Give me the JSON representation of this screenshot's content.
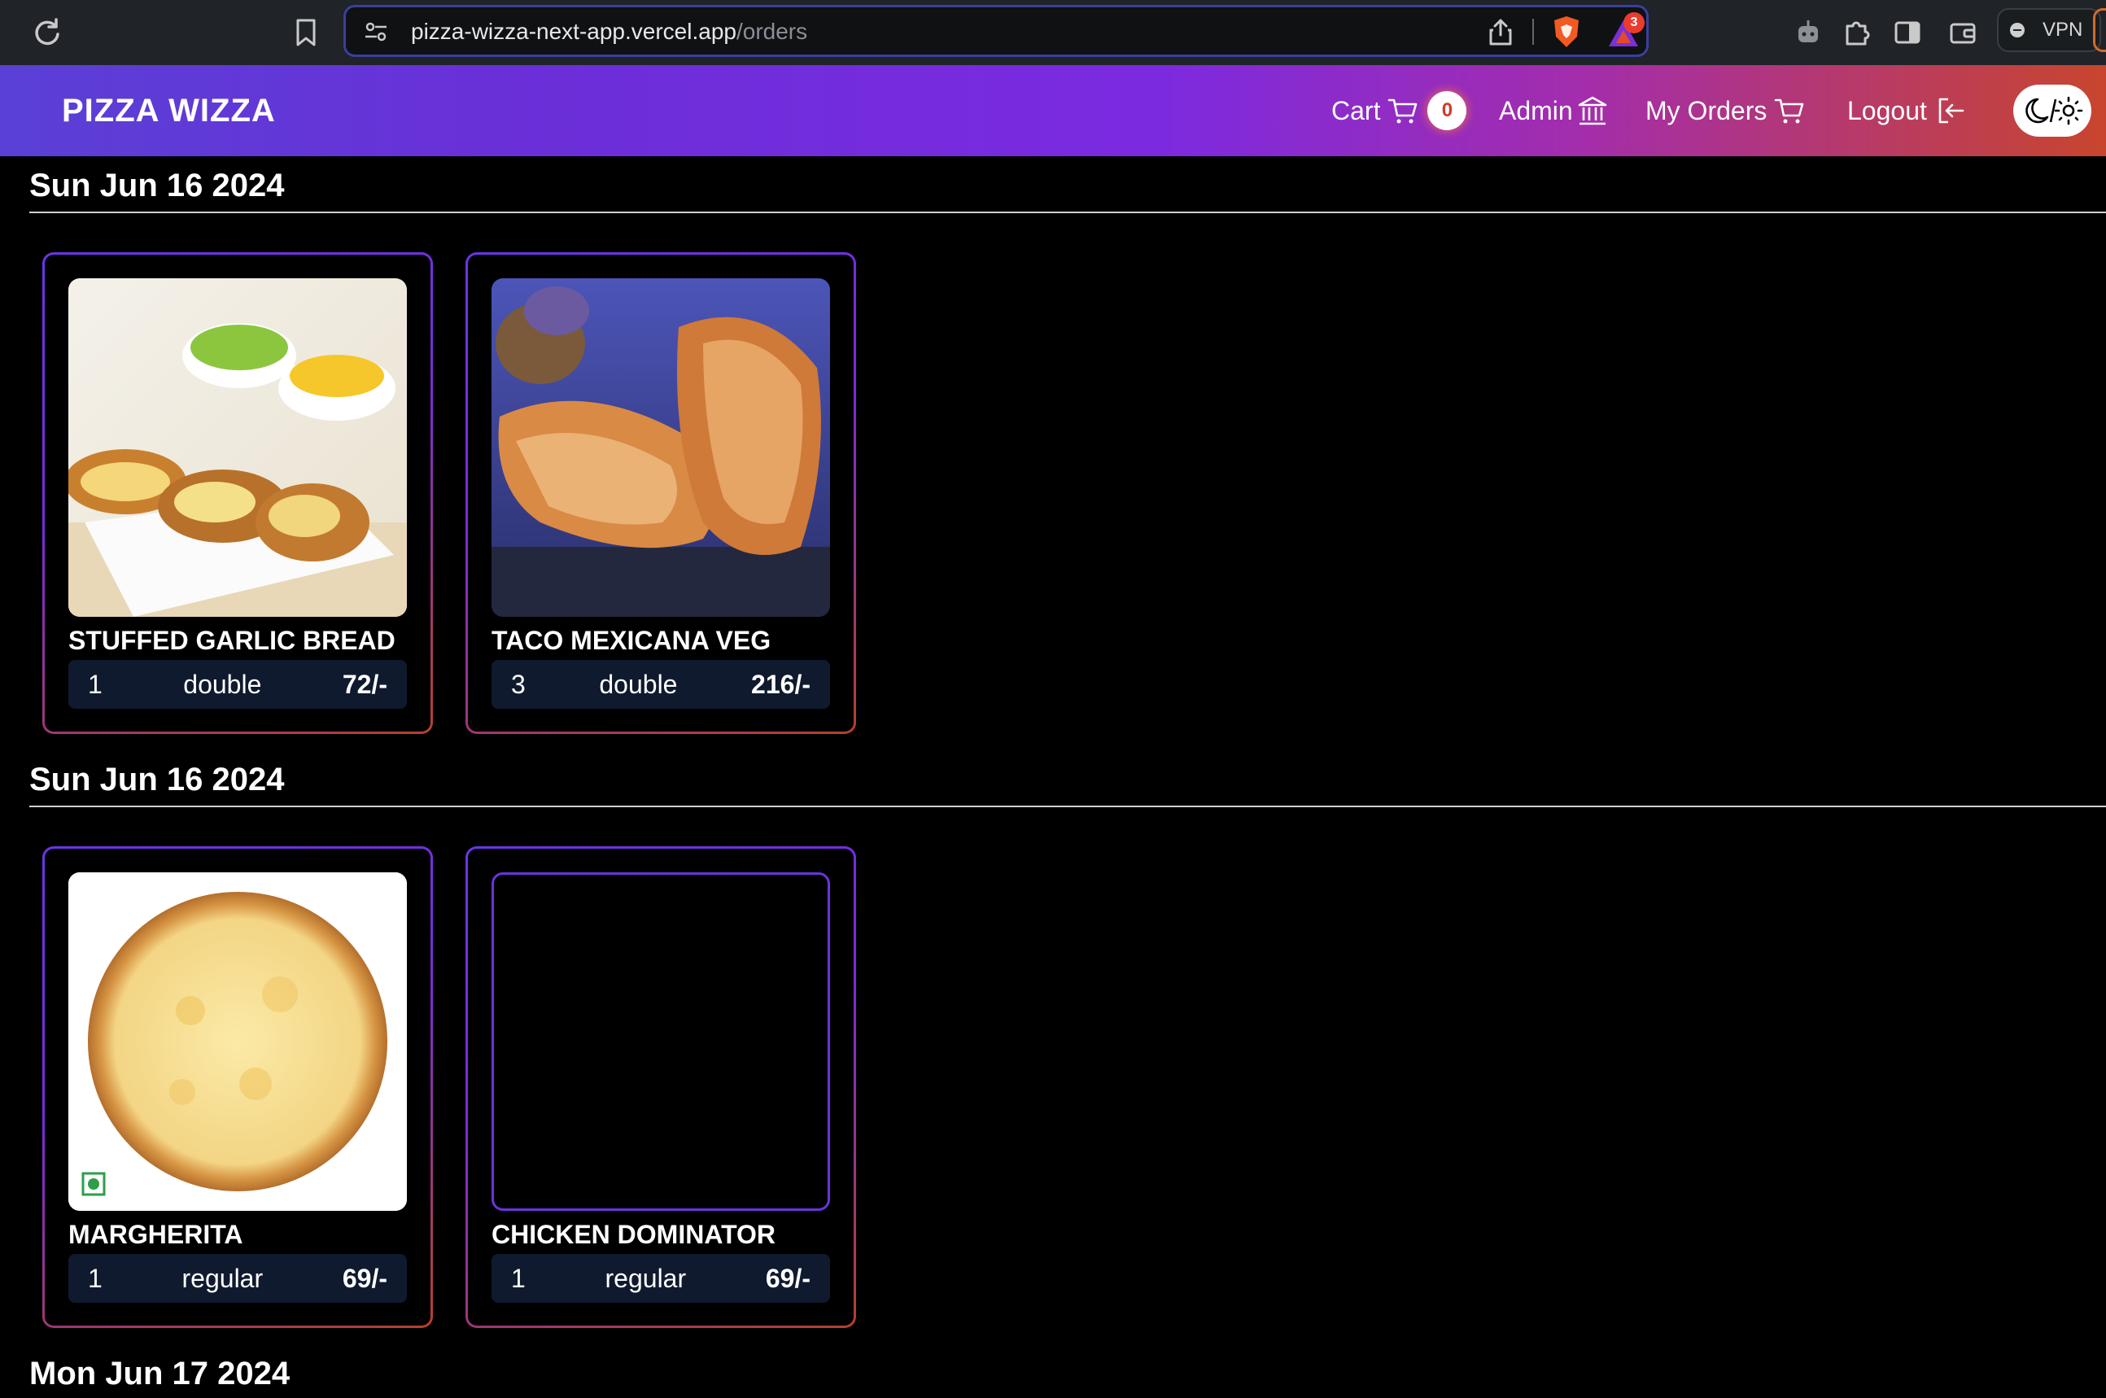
{
  "browser": {
    "url_host": "pizza-wizza-next-app.vercel.app",
    "url_path": "/orders",
    "rewards_count": "3",
    "vpn_label": "VPN",
    "accent": "#3a3f9e"
  },
  "header": {
    "logo": "PIZZA WIZZA",
    "nav": {
      "cart_label": "Cart",
      "cart_count": "0",
      "admin_label": "Admin",
      "orders_label": "My Orders",
      "logout_label": "Logout"
    },
    "gradient": [
      "#5a40d6",
      "#7c2ae0",
      "#c8452d"
    ]
  },
  "orders": [
    {
      "date": "Sun Jun 16 2024",
      "items": [
        {
          "name": "STUFFED GARLIC BREAD",
          "qty": "1",
          "variant": "double",
          "price": "72/-",
          "image": "garlic-bread-photo"
        },
        {
          "name": "TACO MEXICANA VEG",
          "qty": "3",
          "variant": "double",
          "price": "216/-",
          "image": "taco-photo"
        }
      ]
    },
    {
      "date": "Sun Jun 16 2024",
      "items": [
        {
          "name": "MARGHERITA",
          "qty": "1",
          "variant": "regular",
          "price": "69/-",
          "image": "margherita-photo"
        },
        {
          "name": "CHICKEN DOMINATOR",
          "qty": "1",
          "variant": "regular",
          "price": "69/-",
          "image": "none"
        }
      ]
    },
    {
      "date": "Mon Jun 17 2024",
      "items": []
    }
  ]
}
